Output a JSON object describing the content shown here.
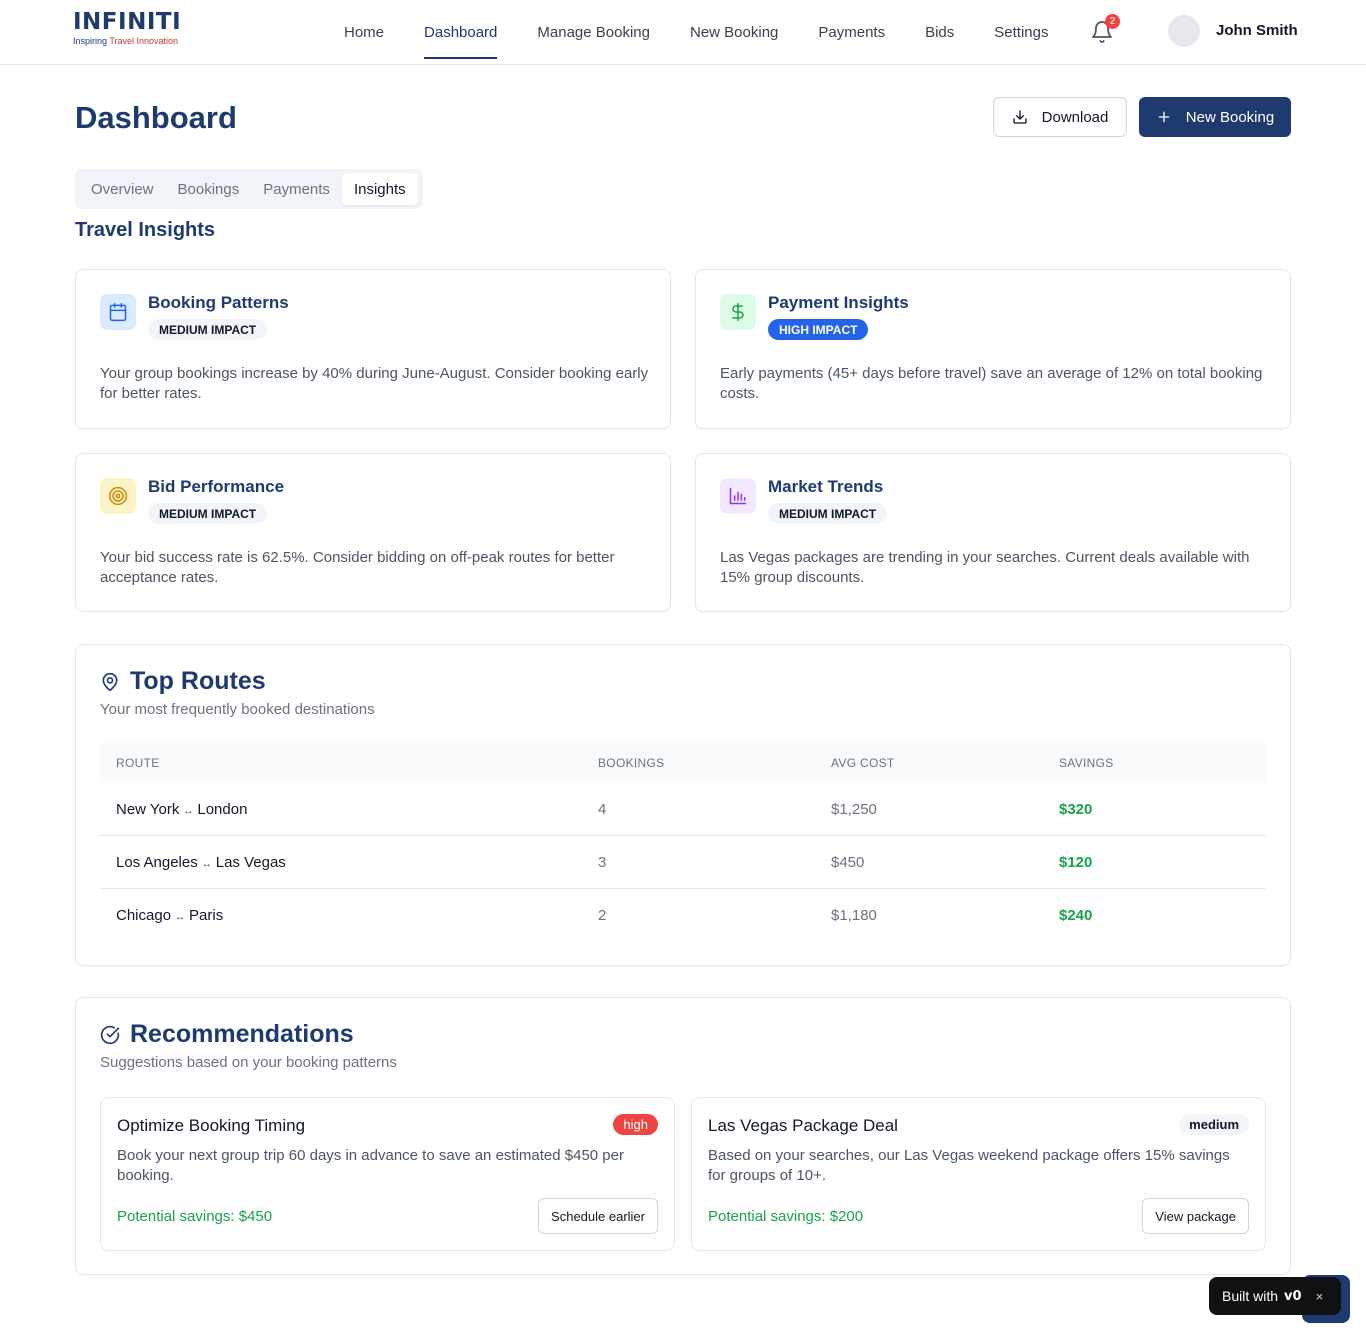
{
  "header": {
    "logo_text": "INFINITI",
    "logo_tag_prefix": "Inspiring ",
    "logo_tag_highlight": "Travel Innovation",
    "nav": [
      {
        "label": "Home"
      },
      {
        "label": "Dashboard",
        "active": true
      },
      {
        "label": "Manage Booking"
      },
      {
        "label": "New Booking"
      },
      {
        "label": "Payments"
      },
      {
        "label": "Bids"
      },
      {
        "label": "Settings"
      }
    ],
    "notification_count": "2",
    "user_name": "John Smith"
  },
  "page": {
    "title": "Dashboard",
    "download_label": "Download",
    "new_booking_label": "New Booking"
  },
  "tabs": [
    {
      "label": "Overview"
    },
    {
      "label": "Bookings"
    },
    {
      "label": "Payments"
    },
    {
      "label": "Insights",
      "active": true
    }
  ],
  "insights": {
    "title": "Travel Insights",
    "cards": [
      {
        "title": "Booking Patterns",
        "impact": "MEDIUM IMPACT",
        "level": "medium",
        "icon": "calendar-icon",
        "desc": "Your group bookings increase by 40% during June-August. Consider booking early for better rates."
      },
      {
        "title": "Payment Insights",
        "impact": "HIGH IMPACT",
        "level": "high",
        "icon": "dollar-icon",
        "desc": "Early payments (45+ days before travel) save an average of 12% on total booking costs."
      },
      {
        "title": "Bid Performance",
        "impact": "MEDIUM IMPACT",
        "level": "medium",
        "icon": "target-icon",
        "desc": "Your bid success rate is 62.5%. Consider bidding on off-peak routes for better acceptance rates."
      },
      {
        "title": "Market Trends",
        "impact": "MEDIUM IMPACT",
        "level": "medium",
        "icon": "bar-chart-icon",
        "desc": "Las Vegas packages are trending in your searches. Current deals available with 15% group discounts."
      }
    ]
  },
  "routes": {
    "title": "Top Routes",
    "subtitle": "Your most frequently booked destinations",
    "columns": [
      "ROUTE",
      "BOOKINGS",
      "AVG COST",
      "SAVINGS"
    ],
    "arrow": "↔",
    "rows": [
      {
        "from": "New York",
        "to": "London",
        "bookings": "4",
        "avg_cost": "$1,250",
        "savings": "$320"
      },
      {
        "from": "Los Angeles",
        "to": "Las Vegas",
        "bookings": "3",
        "avg_cost": "$450",
        "savings": "$120"
      },
      {
        "from": "Chicago",
        "to": "Paris",
        "bookings": "2",
        "avg_cost": "$1,180",
        "savings": "$240"
      }
    ]
  },
  "recommendations": {
    "title": "Recommendations",
    "subtitle": "Suggestions based on your booking patterns",
    "items": [
      {
        "title": "Optimize Booking Timing",
        "priority": "high",
        "desc": "Book your next group trip 60 days in advance to save an estimated $450 per booking.",
        "savings": "Potential savings: $450",
        "action": "Schedule earlier"
      },
      {
        "title": "Las Vegas Package Deal",
        "priority": "medium",
        "desc": "Based on your searches, our Las Vegas weekend package offers 15% savings for groups of 10+.",
        "savings": "Potential savings: $200",
        "action": "View package"
      }
    ]
  },
  "built_with": {
    "label": "Built with",
    "logo": "v0",
    "close": "×"
  },
  "colors": {
    "brand": "#1e3a6e",
    "high": "#2563eb",
    "danger": "#ef4444",
    "success": "#16a34a"
  }
}
